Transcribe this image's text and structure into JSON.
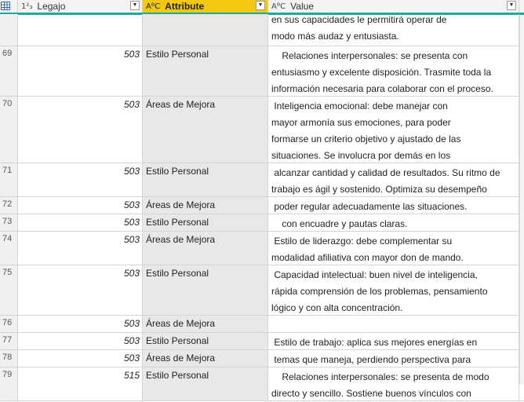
{
  "columns": {
    "index_menu_icon": "table-grid-icon",
    "legajo": {
      "type_icon": "1²₃",
      "title": "Legajo"
    },
    "attribute": {
      "type_icon": "AᴮC",
      "title": "Attribute"
    },
    "value": {
      "type_icon": "AᴮC",
      "title": "Value"
    },
    "dropdown_glyph": "▼"
  },
  "accent": {
    "teal": "#1fa99a",
    "selected_header": "#f2c811"
  },
  "rows": [
    {
      "index": "",
      "legajo": "",
      "attribute": "",
      "value": [
        "en sus capacidades le permitirá operar de",
        "modo más audaz y entusiasta."
      ]
    },
    {
      "index": "69",
      "legajo": "503",
      "attribute": "Estilo Personal",
      "value": [
        "    Relaciones interpersonales: se presenta con",
        "entusiasmo y excelente disposición. Trasmite toda la",
        "información necesaria para colaborar con el proceso."
      ]
    },
    {
      "index": "70",
      "legajo": "503",
      "attribute": "Áreas de Mejora",
      "value": [
        " Inteligencia emocional: debe manejar con",
        "mayor armonía sus emociones, para poder",
        "formarse un criterio objetivo y ajustado de las",
        "situaciones. Se involucra por demás en los"
      ]
    },
    {
      "index": "71",
      "legajo": "503",
      "attribute": "Estilo Personal",
      "value": [
        " alcanzar cantidad y calidad de resultados. Su ritmo de",
        "trabajo es ágil y sostenido. Optimiza su desempeño"
      ]
    },
    {
      "index": "72",
      "legajo": "503",
      "attribute": "Áreas de Mejora",
      "value": [
        " poder regular adecuadamente las situaciones."
      ]
    },
    {
      "index": "73",
      "legajo": "503",
      "attribute": "Estilo Personal",
      "value": [
        "    con encuadre y pautas claras."
      ]
    },
    {
      "index": "74",
      "legajo": "503",
      "attribute": "Áreas de Mejora",
      "value": [
        " Estilo de liderazgo: debe complementar su",
        "modalidad afiliativa con mayor don de mando."
      ]
    },
    {
      "index": "75",
      "legajo": "503",
      "attribute": "Estilo Personal",
      "value": [
        " Capacidad intelectual: buen nivel de inteligencia,",
        "rápida comprensión de los problemas, pensamiento",
        "lógico y con alta concentración."
      ]
    },
    {
      "index": "76",
      "legajo": "503",
      "attribute": "Áreas de Mejora",
      "value": [
        ""
      ]
    },
    {
      "index": "77",
      "legajo": "503",
      "attribute": "Estilo Personal",
      "value": [
        " Estilo de trabajo: aplica sus mejores energías en"
      ]
    },
    {
      "index": "78",
      "legajo": "503",
      "attribute": "Áreas de Mejora",
      "value": [
        " temas que maneja, perdiendo perspectiva para"
      ]
    },
    {
      "index": "79",
      "legajo": "515",
      "attribute": "Estilo Personal",
      "value": [
        "    Relaciones interpersonales: se presenta de modo",
        "directo y sencillo. Sostiene buenos vínculos con"
      ]
    }
  ]
}
